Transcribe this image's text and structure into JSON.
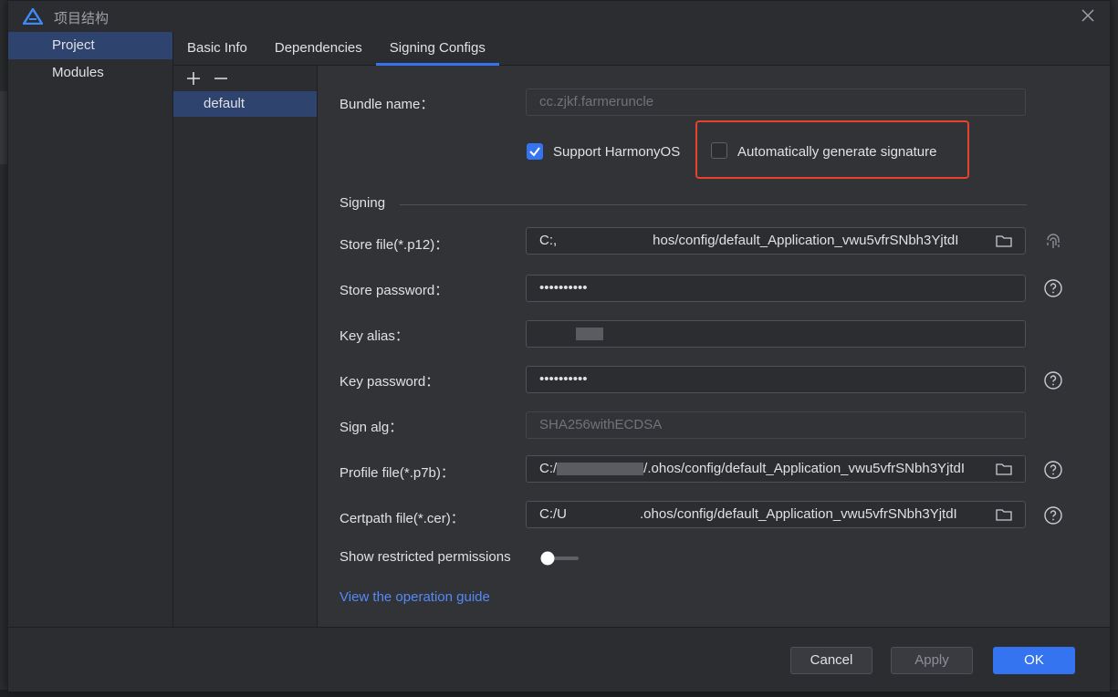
{
  "window": {
    "title": "项目结构"
  },
  "left_nav": {
    "items": [
      {
        "label": "Project",
        "selected": true
      },
      {
        "label": "Modules",
        "selected": false
      }
    ]
  },
  "tabs": [
    {
      "label": "Basic Info",
      "active": false
    },
    {
      "label": "Dependencies",
      "active": false
    },
    {
      "label": "Signing Configs",
      "active": true
    }
  ],
  "config_list": {
    "add_symbol": "+",
    "remove_symbol": "−",
    "items": [
      "default"
    ]
  },
  "form": {
    "bundle_name_label": "Bundle name：",
    "bundle_name_value": "cc.zjkf.farmeruncle",
    "support_harmonyos_label": "Support HarmonyOS",
    "support_harmonyos_checked": true,
    "auto_generate_label": "Automatically generate signature",
    "auto_generate_checked": false,
    "signing_section": "Signing",
    "store_file_label": "Store file(*.p12)：",
    "store_file_value_prefix": "C:,",
    "store_file_value_suffix": "hos/config/default_Application_vwu5vfrSNbh3YjtdI",
    "store_password_label": "Store password：",
    "store_password_value": "••••••••••",
    "key_alias_label": "Key alias：",
    "key_password_label": "Key password：",
    "key_password_value": "••••••••••",
    "sign_alg_label": "Sign alg：",
    "sign_alg_value": "SHA256withECDSA",
    "profile_file_label": "Profile file(*.p7b)：",
    "profile_file_value_prefix": "C:/",
    "profile_file_value_suffix": "/.ohos/config/default_Application_vwu5vfrSNbh3YjtdI",
    "certpath_file_label": "Certpath file(*.cer)：",
    "certpath_file_value_prefix": "C:/U",
    "certpath_file_value_suffix": ".ohos/config/default_Application_vwu5vfrSNbh3YjtdI",
    "restricted_permissions_label": "Show restricted permissions",
    "restricted_permissions_on": false,
    "guide_link": "View the operation guide"
  },
  "footer": {
    "cancel": "Cancel",
    "apply": "Apply",
    "ok": "OK"
  },
  "colors": {
    "accent": "#3574f0",
    "highlight_box": "#e8412c",
    "link": "#548af7",
    "selection": "#2e436e"
  }
}
